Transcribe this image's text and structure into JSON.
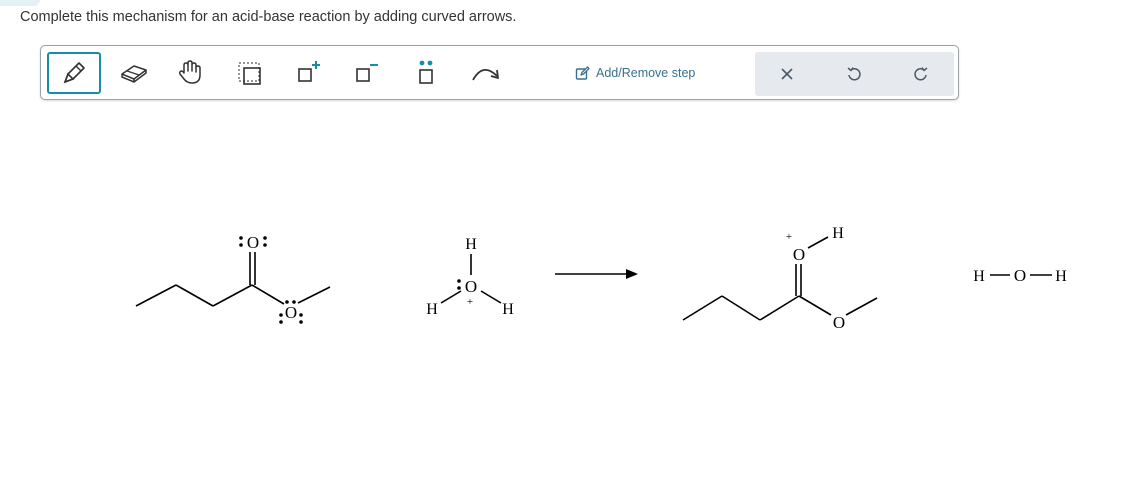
{
  "prompt": "Complete this mechanism for an acid-base reaction by adding curved arrows.",
  "toolbar": {
    "tools": [
      {
        "name": "pencil-icon",
        "active": true
      },
      {
        "name": "eraser-icon",
        "active": false
      },
      {
        "name": "hand-icon",
        "active": false
      },
      {
        "name": "select-box-icon",
        "active": false
      },
      {
        "name": "add-charge-positive-icon",
        "active": false
      },
      {
        "name": "add-charge-negative-icon",
        "active": false
      },
      {
        "name": "lone-pair-icon",
        "active": false
      },
      {
        "name": "curved-arrow-icon",
        "active": false
      }
    ],
    "step_label": "Add/Remove step",
    "clear_icon": "close-icon",
    "undo_icon": "undo-icon",
    "redo_icon": "redo-icon"
  },
  "molecules": {
    "reactant_ester": {
      "carbonyl_oxygen": "O",
      "ether_oxygen": "O"
    },
    "hydronium": {
      "oxygen": "O",
      "h_top": "H",
      "h_left": "H",
      "h_right": "H",
      "charge": "+"
    },
    "product_ester": {
      "carbonyl_oxygen": "O",
      "h": "H",
      "ether_oxygen": "O",
      "charge": "+"
    },
    "water": {
      "h_left": "H",
      "oxygen": "O",
      "h_right": "H"
    }
  },
  "colors": {
    "accent": "#168fa6",
    "link": "#3a6f8f",
    "group_bg": "#e6eaee"
  }
}
